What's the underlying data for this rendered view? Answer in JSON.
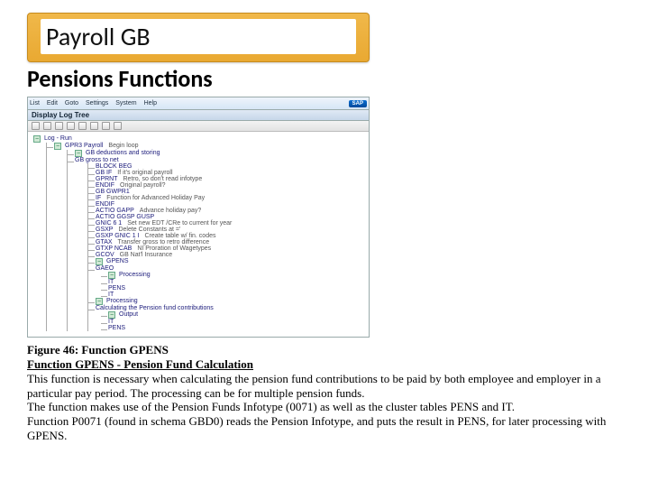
{
  "title": "Payroll GB",
  "subtitle": "Pensions Functions",
  "sap": {
    "menu": [
      "List",
      "Edit",
      "Goto",
      "Settings",
      "System",
      "Help"
    ],
    "logo": "SAP",
    "page_title": "Display Log Tree",
    "toolbar_icons": [
      "back-icon",
      "up-icon",
      "run-icon",
      "cancel-icon",
      "search-icon",
      "print-icon",
      "export-icon",
      "config-icon"
    ]
  },
  "tree": {
    "root": "Log - Run",
    "main": "GPR3 Payroll",
    "main_comment": "Begin loop",
    "sub_root": "GB deductions and storing",
    "sub_line": "GB gross to net",
    "rows": [
      {
        "label": "BLOCK BEG",
        "comment": ""
      },
      {
        "label": "GB IF",
        "comment": "If it's original payroll"
      },
      {
        "label": "GPRNT",
        "comment": "Retro, so don't read infotype"
      },
      {
        "label": "ENDIF",
        "comment": "Original payroll?"
      },
      {
        "label": "GB GWPR1",
        "comment": ""
      },
      {
        "label": "IF",
        "comment": "Function for Advanced Holiday Pay"
      },
      {
        "label": "ENDIF",
        "comment": ""
      },
      {
        "label": "ACTIO GAPP",
        "comment": "Advance holiday pay?"
      },
      {
        "label": "ACTIO GGSP GUSP",
        "comment": ""
      },
      {
        "label": "GNIC 6 1",
        "comment": "Set new EDT /CRe to current for year"
      },
      {
        "label": "GSXP",
        "comment": "Delete Constants at ='"
      },
      {
        "label": "GSXP GNIC 1 I",
        "comment": "Create table w/ fin. codes"
      },
      {
        "label": "GTAX",
        "comment": "Transfer gross to retro difference"
      },
      {
        "label": "GTXP NCAB",
        "comment": "NI Proration of Wagetypes"
      },
      {
        "label": "GCOV",
        "comment": "GB Nat'l Insurance"
      },
      {
        "label": "GPENS",
        "comment": ""
      },
      {
        "label": "GAEO",
        "comment": ""
      },
      {
        "label": "Processing",
        "comment": ""
      },
      {
        "label": "IT",
        "comment": ""
      },
      {
        "label": "PENS",
        "comment": ""
      },
      {
        "label": "IT",
        "comment": ""
      },
      {
        "label": "Processing",
        "comment": ""
      },
      {
        "label": "Calculating the Pension fund contributions",
        "comment": ""
      },
      {
        "label": "Output",
        "comment": ""
      },
      {
        "label": "IT",
        "comment": ""
      },
      {
        "label": "PENS",
        "comment": ""
      }
    ]
  },
  "caption": {
    "figure_label": "Figure 46: Function GPENS",
    "fn_head": "Function GPENS - Pension Fund Calculation",
    "body1": "This function is necessary when calculating the pension fund contributions to be paid by both employee and employer in a particular pay period. The processing can be for multiple pension funds.",
    "body2": "The function makes use of the Pension Funds Infotype (0071) as well as the cluster tables PENS and IT.",
    "body3": "Function P0071 (found in schema GBD0) reads the Pension Infotype, and puts the result in PENS, for later processing with GPENS."
  }
}
